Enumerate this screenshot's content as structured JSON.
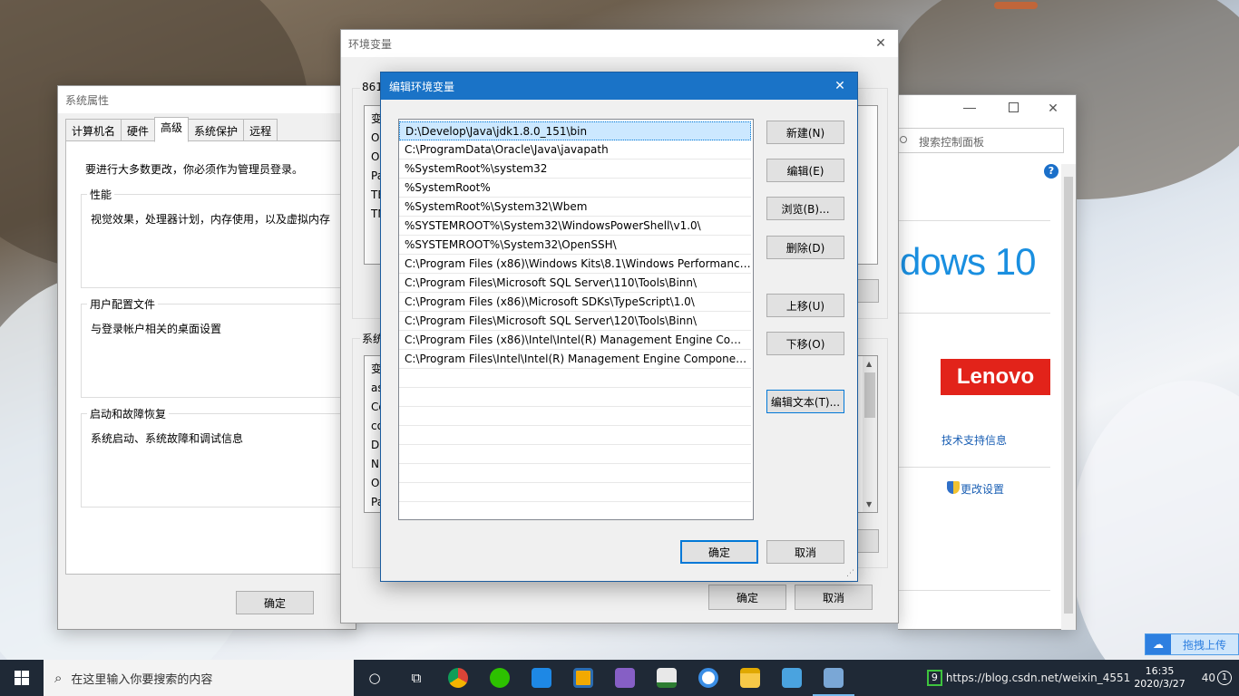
{
  "system_props": {
    "title": "系统属性",
    "tabs": [
      "计算机名",
      "硬件",
      "高级",
      "系统保护",
      "远程"
    ],
    "admin_note": "要进行大多数更改，你必须作为管理员登录。",
    "groups": [
      {
        "title": "性能",
        "text": "视觉效果，处理器计划，内存使用，以及虚拟内存"
      },
      {
        "title": "用户配置文件",
        "text": "与登录帐户相关的桌面设置"
      },
      {
        "title": "启动和故障恢复",
        "text": "系统启动、系统故障和调试信息"
      }
    ],
    "ok": "确定"
  },
  "env_vars": {
    "title": "环境变量",
    "user_section_label": "861",
    "user_list_fragments": [
      "变",
      "O",
      "O",
      "Pa",
      "TE",
      "TN"
    ],
    "system_section_label": "系统",
    "system_list_fragments": [
      "变",
      "as",
      "Co",
      "co",
      "Dr",
      "N",
      "O",
      "Pa"
    ],
    "ok": "确定",
    "cancel": "取消"
  },
  "edit_dialog": {
    "title": "编辑环境变量",
    "paths": [
      "D:\\Develop\\Java\\jdk1.8.0_151\\bin",
      "C:\\ProgramData\\Oracle\\Java\\javapath",
      "%SystemRoot%\\system32",
      "%SystemRoot%",
      "%SystemRoot%\\System32\\Wbem",
      "%SYSTEMROOT%\\System32\\WindowsPowerShell\\v1.0\\",
      "%SYSTEMROOT%\\System32\\OpenSSH\\",
      "C:\\Program Files (x86)\\Windows Kits\\8.1\\Windows Performance...",
      "C:\\Program Files\\Microsoft SQL Server\\110\\Tools\\Binn\\",
      "C:\\Program Files (x86)\\Microsoft SDKs\\TypeScript\\1.0\\",
      "C:\\Program Files\\Microsoft SQL Server\\120\\Tools\\Binn\\",
      "C:\\Program Files (x86)\\Intel\\Intel(R) Management Engine Comp...",
      "C:\\Program Files\\Intel\\Intel(R) Management Engine Component..."
    ],
    "empty_rows": 7,
    "buttons": {
      "new": "新建(N)",
      "edit": "编辑(E)",
      "browse": "浏览(B)...",
      "delete": "删除(D)",
      "up": "上移(U)",
      "down": "下移(O)",
      "edit_text": "编辑文本(T)..."
    },
    "ok": "确定",
    "cancel": "取消"
  },
  "control_panel": {
    "search_placeholder": "搜索控制面板",
    "windows_text": "dows 10",
    "brand": "Lenovo",
    "support_link": "技术支持信息",
    "change_settings": "更改设置"
  },
  "upload_widget": {
    "label": "拖拽上传"
  },
  "taskbar": {
    "search_placeholder": "在这里输入你要搜索的内容",
    "time": "16:35",
    "date": "2020/3/27",
    "watermark": "https://blog.csdn.net/weixin_4551",
    "watermark_tail": "40",
    "tray_box": "9",
    "notif_count": "1",
    "colors": {
      "bg": "#1f2936",
      "accent": "#76b9ed"
    }
  }
}
